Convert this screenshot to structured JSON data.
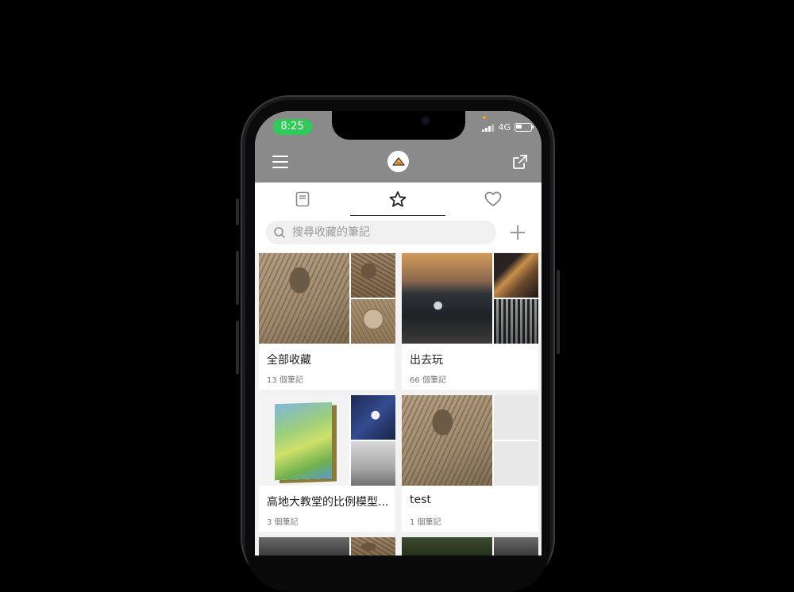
{
  "status_bar": {
    "time": "8:25",
    "network": "4G"
  },
  "search": {
    "placeholder": "搜尋收藏的筆記"
  },
  "tabs": [
    {
      "icon": "notebook-icon",
      "active": false
    },
    {
      "icon": "star-icon",
      "active": true
    },
    {
      "icon": "heart-icon",
      "active": false
    }
  ],
  "collections": [
    {
      "title": "全部收藏",
      "count": "13 個筆記"
    },
    {
      "title": "出去玩",
      "count": "66 個筆記"
    },
    {
      "title": "高地大教堂的比例模型...",
      "count": "3 個筆記"
    },
    {
      "title": "test",
      "count": "1 個筆記"
    }
  ],
  "colors": {
    "header": "#8a8a8a",
    "time_pill": "#30c95a",
    "background": "#f2f2f2"
  }
}
